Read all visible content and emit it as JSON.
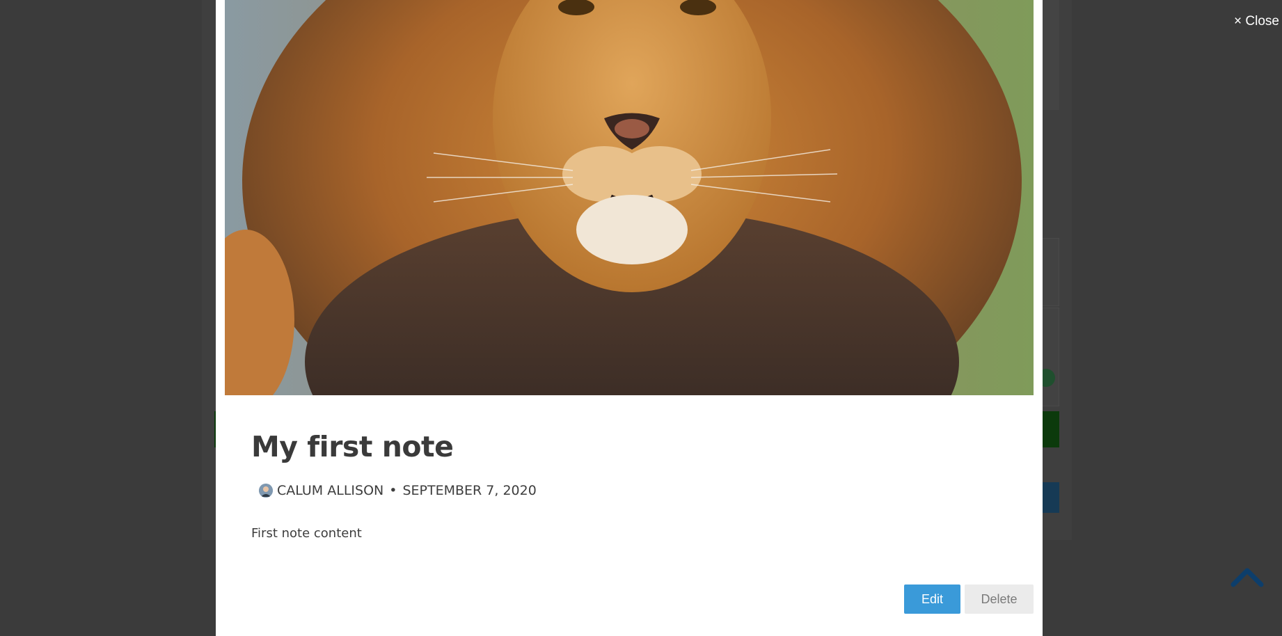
{
  "close": {
    "label": "× Close"
  },
  "note": {
    "title": "My first note",
    "author": "CALUM ALLISON",
    "separator": "•",
    "date": "SEPTEMBER 7, 2020",
    "content": "First note content",
    "image_subject": "lion"
  },
  "actions": {
    "edit_label": "Edit",
    "delete_label": "Delete"
  },
  "icons": {
    "back_to_top": "chevron-up-icon",
    "avatar": "user-avatar"
  },
  "colors": {
    "overlay": "#3b3b3b",
    "edit_button": "#3a9ad9",
    "delete_button": "#ebebeb",
    "back_to_top": "#0d3e6b"
  }
}
